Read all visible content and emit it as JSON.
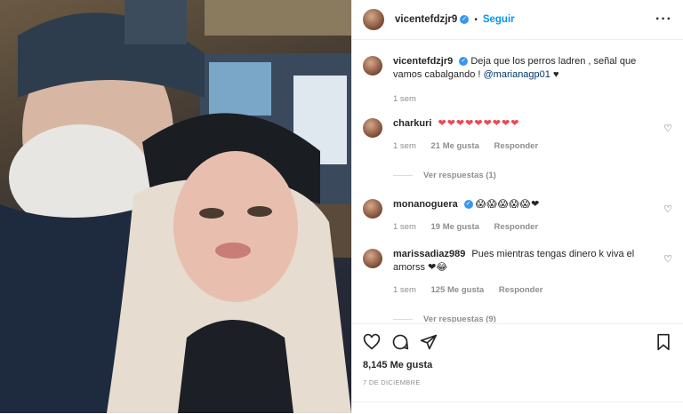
{
  "header": {
    "username": "vicentefdzjr9",
    "follow_label": "Seguir",
    "separator": "•",
    "more_icon": "more-horizontal-icon"
  },
  "caption": {
    "username": "vicentefdzjr9",
    "text": "Deja que los perros ladren , señal que vamos cabalgando !",
    "mention": "@marianagp01",
    "emoji": "♥",
    "time": "1 sem"
  },
  "comments": [
    {
      "username": "charkuri",
      "text": "❤❤❤❤❤❤❤❤❤",
      "time": "1 sem",
      "likes": "21 Me gusta",
      "reply": "Responder",
      "view_replies": "Ver respuestas (1)"
    },
    {
      "username": "monanoguera",
      "text": "😱😱😱😱😱❤",
      "time": "1 sem",
      "likes": "19 Me gusta",
      "reply": "Responder"
    },
    {
      "username": "marissadiaz989",
      "text": "Pues mientras tengas dinero k viva el amorss ❤😂",
      "time": "1 sem",
      "likes": "125 Me gusta",
      "reply": "Responder",
      "view_replies": "Ver respuestas (9)"
    }
  ],
  "footer": {
    "likes": "8,145 Me gusta",
    "date": "7 DE DICIEMBRE"
  },
  "colors": {
    "link": "#0095f6",
    "verified": "#3897f0",
    "heart": "#ed4956"
  }
}
